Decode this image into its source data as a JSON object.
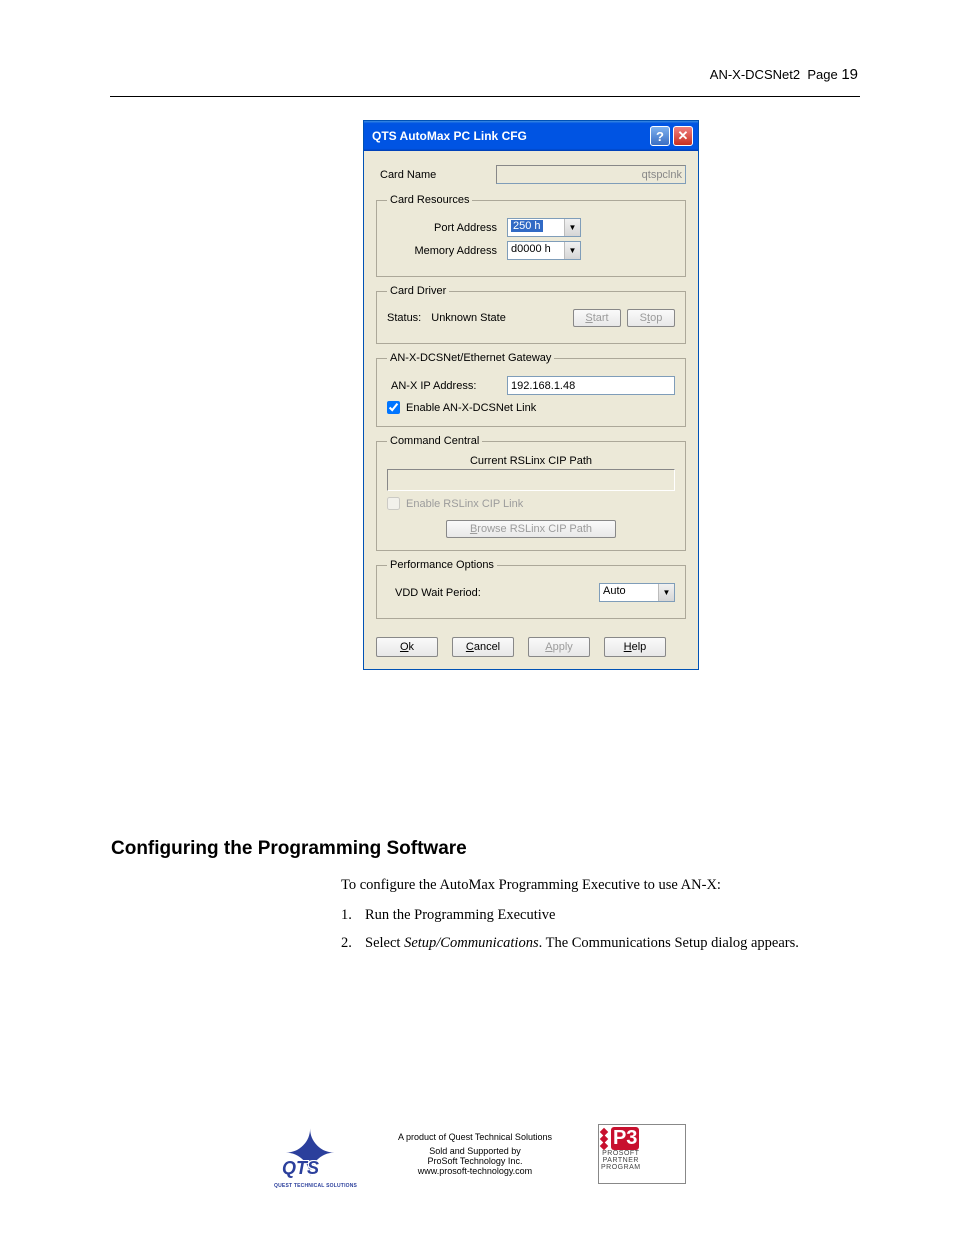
{
  "header": {
    "doc": "AN-X-DCSNet2",
    "page_label": "Page",
    "page_num": "19"
  },
  "dialog": {
    "title": "QTS AutoMax PC Link CFG",
    "card_name_label": "Card Name",
    "card_name_value": "qtspclnk",
    "resources": {
      "legend": "Card Resources",
      "port_label": "Port Address",
      "port_value": "250 h",
      "mem_label": "Memory Address",
      "mem_value": "d0000 h"
    },
    "driver": {
      "legend": "Card Driver",
      "status_label": "Status:",
      "status_value": "Unknown State",
      "start": "Start",
      "stop": "Stop"
    },
    "gateway": {
      "legend": "AN-X-DCSNet/Ethernet Gateway",
      "ip_label": "AN-X IP Address:",
      "ip_value": "192.168.1.48",
      "enable_label": "Enable AN-X-DCSNet Link"
    },
    "command": {
      "legend": "Command Central",
      "path_label": "Current RSLinx CIP Path",
      "enable_label": "Enable RSLinx CIP Link",
      "browse": "Browse RSLinx CIP Path"
    },
    "perf": {
      "legend": "Performance Options",
      "wait_label": "VDD Wait Period:",
      "wait_value": "Auto"
    },
    "buttons": {
      "ok": "Ok",
      "cancel": "Cancel",
      "apply": "Apply",
      "help": "Help"
    }
  },
  "section": {
    "heading": "Configuring the Programming Software",
    "intro": "To configure the AutoMax Programming Executive to use AN-X:",
    "li1": "Run the Programming Executive",
    "li2a": "Select ",
    "li2_em": "Setup/Communications",
    "li2b": ".  The Communications Setup dialog appears."
  },
  "footer": {
    "l1": "A product of Quest Technical Solutions",
    "l2": "Sold and Supported by",
    "l3": "ProSoft Technology Inc.",
    "l4": "www.prosoft-technology.com",
    "p3_l1": "PROSOFT",
    "p3_l2": "PARTNER",
    "p3_l3": "PROGRAM"
  }
}
